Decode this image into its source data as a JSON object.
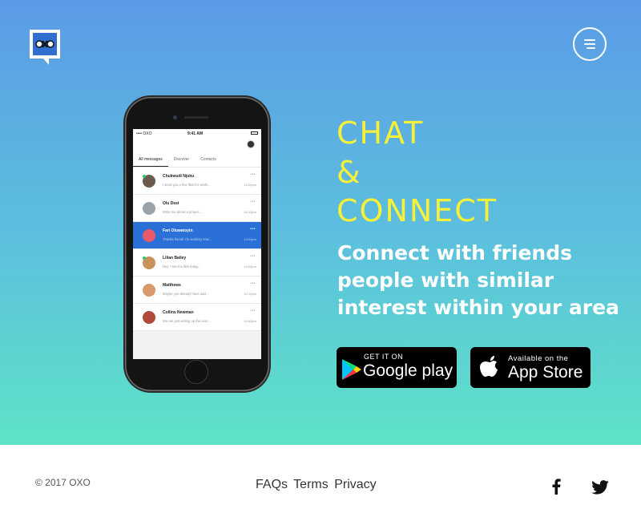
{
  "brand": {
    "logo_text": "OXO"
  },
  "header": {
    "menu_icon": "menu-icon"
  },
  "phone": {
    "status_left": "•••• OXO",
    "status_time": "9:41 AM",
    "tabs": [
      "All messages",
      "Discover",
      "Contacts"
    ],
    "messages": [
      {
        "name": "Chukwudi Njoku",
        "text": "I send you a few files for worki...",
        "time": "10:00pm",
        "color": "#6b5b4e"
      },
      {
        "name": "Olu Desi",
        "text": "Write me about a project...",
        "time": "15:10pm",
        "color": "#9aa3a8"
      },
      {
        "name": "Fari Oluwatoyin",
        "text": "Thanks friend! I'm working now...",
        "time": "14:20pm",
        "color": "#e85a6a"
      },
      {
        "name": "Lilian Bailey",
        "text": "Hey, I send a files today...",
        "time": "14:05pm",
        "color": "#c9925a"
      },
      {
        "name": "Matthews",
        "text": "Maybe you already have add...",
        "time": "12:10pm",
        "color": "#d89a6a"
      },
      {
        "name": "Collins Newman",
        "text": "We are just writing up the user...",
        "time": "12:40pm",
        "color": "#b04a3a"
      }
    ]
  },
  "hero": {
    "headline": [
      "CHAT",
      "&",
      "CONNECT"
    ],
    "subline": "Connect with friends people with similar interest within your area",
    "accent_color": "#f5f03a"
  },
  "stores": {
    "google": {
      "small": "GET IT ON",
      "big": "Google play"
    },
    "apple": {
      "small": "Available on the",
      "big": "App Store"
    }
  },
  "footer": {
    "copyright": "© 2017 OXO",
    "links": [
      "FAQs",
      "Terms",
      "Privacy"
    ],
    "social": [
      "facebook-icon",
      "twitter-icon"
    ]
  }
}
